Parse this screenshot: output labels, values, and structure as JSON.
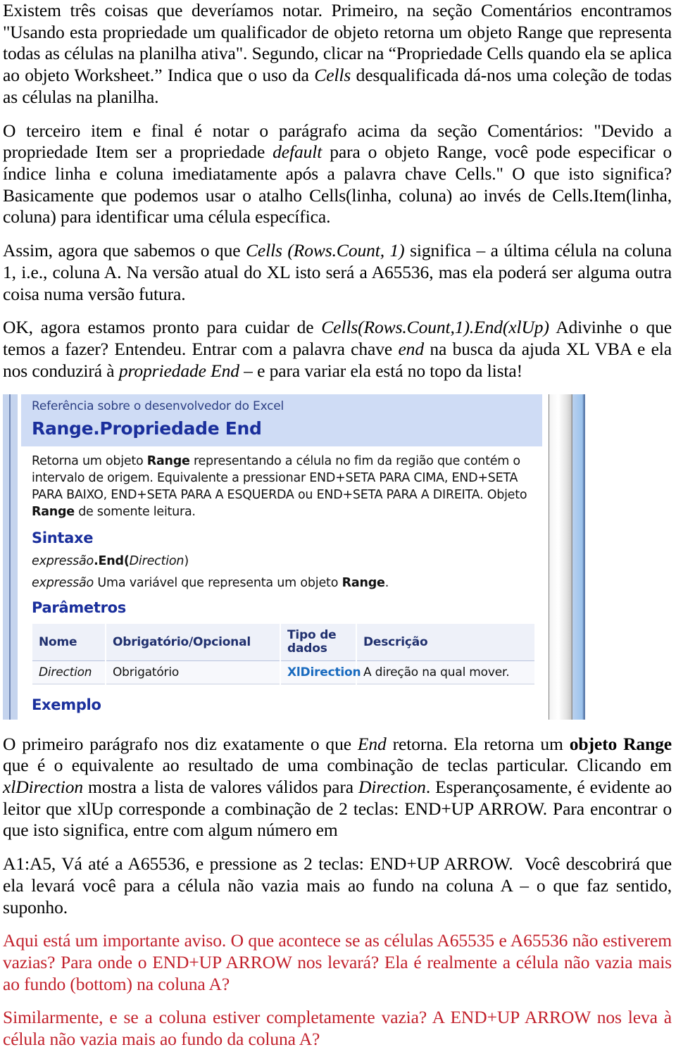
{
  "document": {
    "paragraphs": [
      {
        "id": "p1",
        "text": "Existem três coisas que deveríamos notar. Primeiro, na seção Comentários encontramos \"Usando esta propriedade um qualificador de objeto retorna um objeto Range que representa todas as células na planilha ativa\". Segundo, clicar na “Propriedade Cells quando ela se aplica ao objeto Worksheet.” Indica que o uso da Cells desqualificada dá-nos uma coleção de todas as células na planilha."
      },
      {
        "id": "p2",
        "text": "O terceiro item e final é notar o parágrafo acima da seção Comentários: \"Devido a propriedade Item ser a propriedade default para o objeto Range, você pode especificar o índice linha e coluna imediatamente após a palavra chave Cells.\" O que isto significa? Basicamente que podemos usar o atalho Cells(linha, coluna) ao invés de Cells.Item(linha, coluna) para identificar uma célula específica."
      },
      {
        "id": "p3",
        "text": "Assim, agora que sabemos o que Cells (Rows.Count, 1) significa – a última célula na coluna 1, i.e., coluna A. Na versão atual do XL isto será a A65536, mas ela poderá ser alguma outra coisa numa versão futura."
      },
      {
        "id": "p4",
        "text": "OK, agora estamos pronto para cuidar de Cells(Rows.Count,1).End(xlUp) Adivinhe o que temos a fazer? Entendeu. Entrar com a palavra chave end na busca da ajuda XL VBA e ela nos conduzirá à propriedade End – e para variar ela está no topo da lista!"
      },
      {
        "id": "p5",
        "text": "O primeiro parágrafo nos diz exatamente o que End retorna. Ela retorna um objeto Range que é o equivalente ao resultado de uma combinação de teclas particular. Clicando em xlDirection mostra a lista de valores válidos para Direction. Esperançosamente, é evidente ao leitor que xlUp corresponde a combinação de 2 teclas: END+UP ARROW. Para encontrar o que isto significa, entre com algum número em"
      },
      {
        "id": "p6",
        "text": "A1:A5, Vá até a A65536, e pressione as 2 teclas: END+UP ARROW.  Você descobrirá que ela levará você para a célula não vazia mais ao fundo na coluna A – o que faz sentido, suponho."
      },
      {
        "id": "p7",
        "warning": true,
        "text": "Aqui está um importante aviso. O que acontece se as células A65535 e A65536 não estiverem vazias? Para onde o END+UP ARROW nos levará? Ela é realmente a célula não vazia mais ao fundo (bottom) na coluna A?"
      },
      {
        "id": "p8",
        "warning": true,
        "text": "Similarmente, e se a coluna estiver completamente vazia? A END+UP ARROW nos leva à célula não vazia mais ao fundo da coluna A?"
      }
    ]
  },
  "help_screenshot": {
    "breadcrumb": "Referência sobre o desenvolvedor do Excel",
    "title": "Range.Propriedade End",
    "description_part1": "Retorna um objeto ",
    "description_bold1": "Range",
    "description_part2": " representando a célula no fim da região que contém o intervalo de origem. Equivalente a pressionar END+SETA PARA CIMA, END+SETA PARA BAIXO, END+SETA PARA A ESQUERDA ou END+SETA PARA A DIREITA. Objeto ",
    "description_bold2": "Range",
    "description_part3": " de somente leitura.",
    "syntax_heading": "Sintaxe",
    "syntax_expression_italic": "expressão",
    "syntax_expression_rest": ".End(",
    "syntax_expression_param": "Direction",
    "syntax_expression_close": ")",
    "expression_label": "expressão",
    "expression_desc_pre": "  Uma variável que representa um objeto ",
    "expression_desc_bold": "Range",
    "expression_desc_post": ".",
    "params_heading": "Parâmetros",
    "table": {
      "headers": [
        "Nome",
        "Obrigatório/Opcional",
        "Tipo de dados",
        "Descrição"
      ],
      "rows": [
        {
          "nome": "Direction",
          "obrigatoriedade": "Obrigatório",
          "tipo": "XlDirection",
          "descricao": "A direção na qual mover."
        }
      ]
    },
    "example_heading": "Exemplo",
    "colors": {
      "header_band": "#cfdcf5",
      "title_text": "#1a2f9c",
      "link": "#1a6bbf",
      "scrollbar_accent": "#9bc2ec"
    }
  },
  "colors": {
    "body_text": "#000000",
    "warning_text": "#C2202B",
    "page_background": "#ffffff"
  }
}
